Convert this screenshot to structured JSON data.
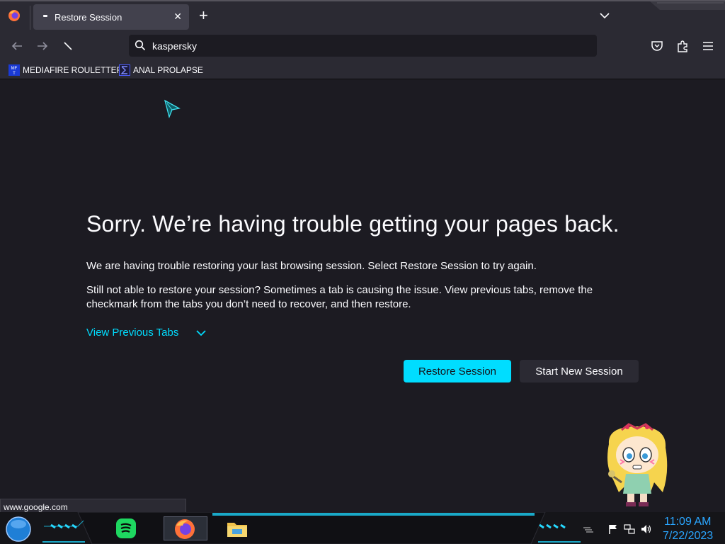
{
  "browser": {
    "tab": {
      "title": "Restore Session",
      "close_glyph": "✕"
    },
    "new_tab_glyph": "+",
    "search": {
      "value": "kaspersky"
    },
    "bookmarks": [
      {
        "label": "MEDIAFIRE ROULETTER",
        "icon": "mediafire-icon",
        "icon_text": "MFT"
      },
      {
        "label": "ANAL PROLAPSE",
        "icon": "sigma-icon"
      }
    ],
    "status_url": "www.google.com"
  },
  "page": {
    "headline": "Sorry. We’re having trouble getting your pages back.",
    "paragraph1": "We are having trouble restoring your last browsing session. Select Restore Session to try again.",
    "paragraph2": "Still not able to restore your session? Sometimes a tab is causing the issue. View previous tabs, remove the checkmark from the tabs you don’t need to recover, and then restore.",
    "view_previous_tabs": "View Previous Tabs",
    "restore_button": "Restore Session",
    "new_session_button": "Start New Session"
  },
  "taskbar": {
    "time": "11:09 AM",
    "date": "7/22/2023"
  },
  "colors": {
    "accent": "#00ddff",
    "background": "#1c1b22",
    "toolbar": "#2b2a33",
    "clock": "#2aa6ff"
  }
}
